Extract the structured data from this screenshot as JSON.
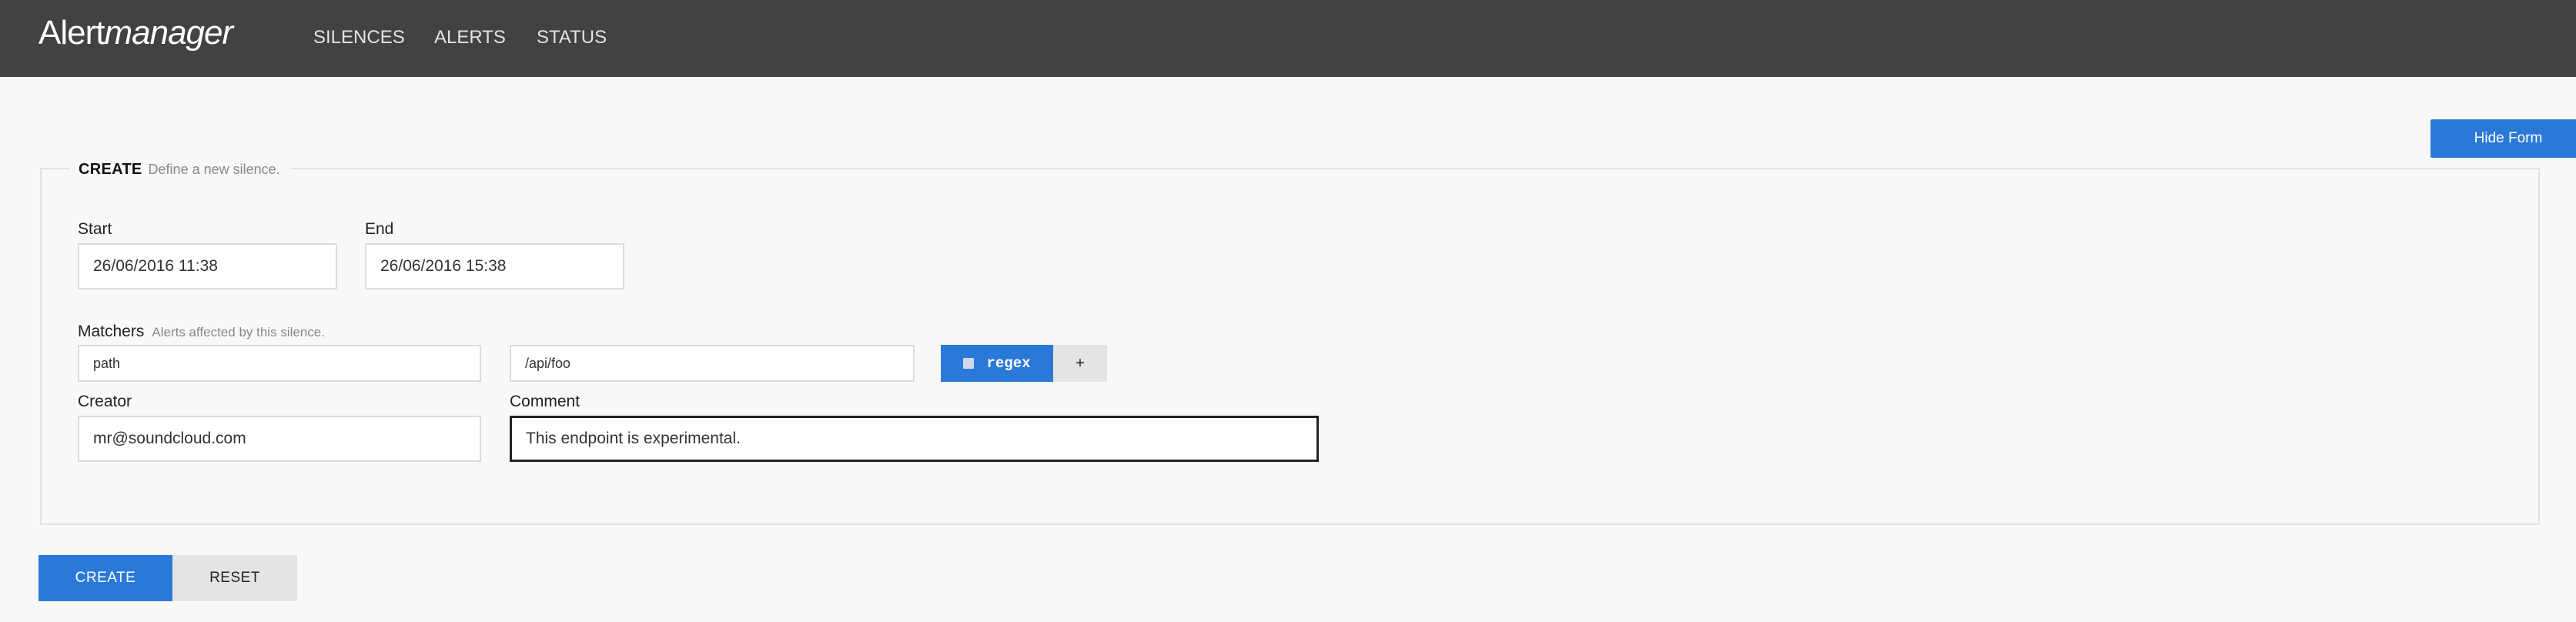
{
  "brand": {
    "part1": "Alert",
    "part2": "manager"
  },
  "nav": {
    "silences": "SILENCES",
    "alerts": "ALERTS",
    "status": "STATUS"
  },
  "hide_form_label": "Hide Form",
  "form": {
    "title": "CREATE",
    "subtitle": "Define a new silence.",
    "start": {
      "label": "Start",
      "value": "26/06/2016 11:38"
    },
    "end": {
      "label": "End",
      "value": "26/06/2016 15:38"
    },
    "matchers": {
      "label": "Matchers",
      "hint": "Alerts affected by this silence.",
      "name_value": "path",
      "value_value": "/api/foo",
      "regex_label": "regex",
      "add_label": "+"
    },
    "creator": {
      "label": "Creator",
      "value": "mr@soundcloud.com"
    },
    "comment": {
      "label": "Comment",
      "value": "This endpoint is experimental."
    }
  },
  "actions": {
    "create": "CREATE",
    "reset": "RESET"
  },
  "colors": {
    "navbar": "#424242",
    "primary": "#2a79d8",
    "secondary": "#e4e4e4",
    "background": "#f8f8f8"
  }
}
